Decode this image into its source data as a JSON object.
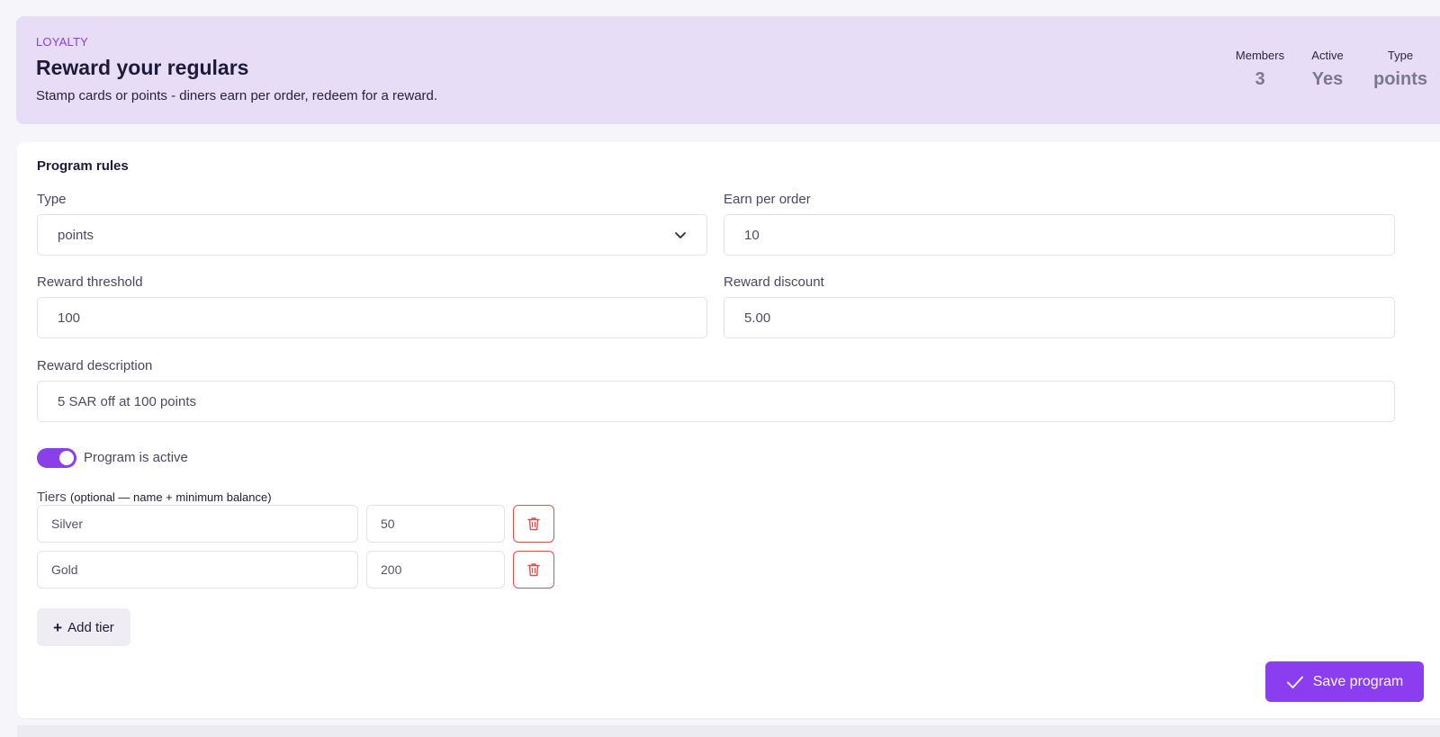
{
  "header": {
    "eyebrow": "LOYALTY",
    "title": "Reward your regulars",
    "subtitle": "Stamp cards or points - diners earn per order, redeem for a reward.",
    "stats": [
      {
        "label": "Members",
        "value": "3"
      },
      {
        "label": "Active",
        "value": "Yes"
      },
      {
        "label": "Type",
        "value": "points"
      }
    ]
  },
  "rules": {
    "title": "Program rules",
    "type": {
      "label": "Type",
      "value": "points",
      "icon": "chevron-down-icon"
    },
    "earn_per_order": {
      "label": "Earn per order",
      "value": "10"
    },
    "reward_threshold": {
      "label": "Reward threshold",
      "value": "100"
    },
    "reward_discount": {
      "label": "Reward discount",
      "value": "5.00"
    },
    "reward_description": {
      "label": "Reward description",
      "value": "5 SAR off at 100 points"
    },
    "active_toggle": {
      "label": "Program is active",
      "on": true
    },
    "tiers": {
      "label": "Tiers",
      "hint": "(optional — name + minimum balance)",
      "rows": [
        {
          "name": "Silver",
          "min": "50"
        },
        {
          "name": "Gold",
          "min": "200"
        }
      ],
      "add_label": "Add tier"
    },
    "save_label": "Save program"
  },
  "colors": {
    "accent": "#8a3ef0",
    "hero_bg": "#e7ddf7",
    "danger": "#d9534f"
  }
}
